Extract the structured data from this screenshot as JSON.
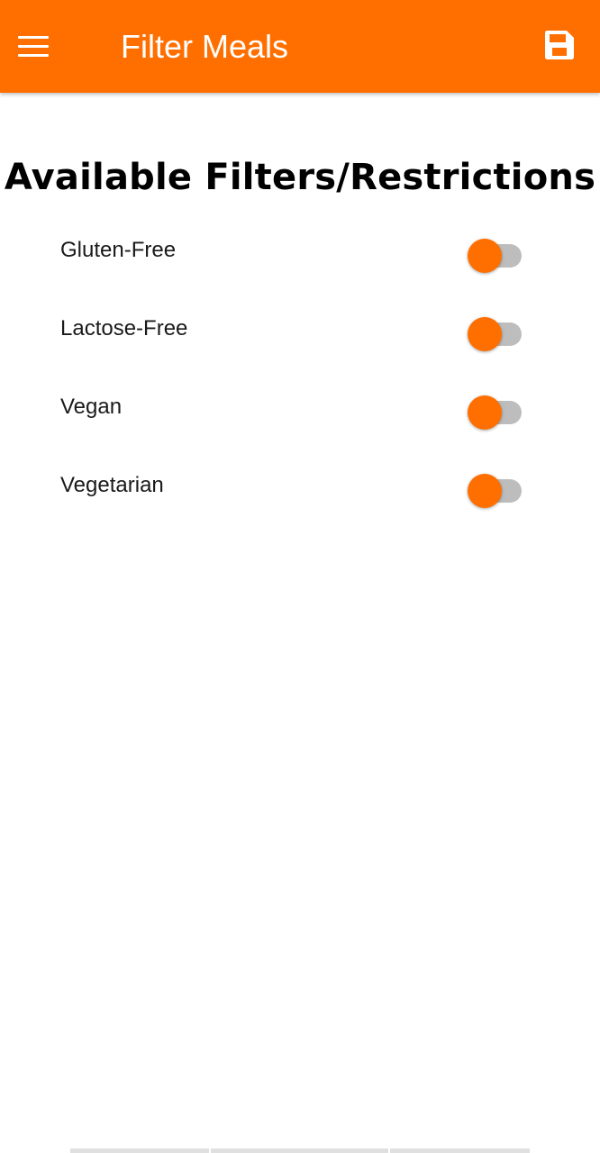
{
  "app_bar": {
    "title": "Filter Meals",
    "background_color": "#ff6f00",
    "menu_icon": "menu-icon",
    "save_icon": "save-icon"
  },
  "heading": "Available Filters/Restrictions",
  "filters": [
    {
      "label": "Gluten-Free",
      "enabled": false
    },
    {
      "label": "Lactose-Free",
      "enabled": false
    },
    {
      "label": "Vegan",
      "enabled": false
    },
    {
      "label": "Vegetarian",
      "enabled": false
    }
  ],
  "colors": {
    "accent": "#ff6f00",
    "switch_track_off": "#bdbdbd"
  }
}
